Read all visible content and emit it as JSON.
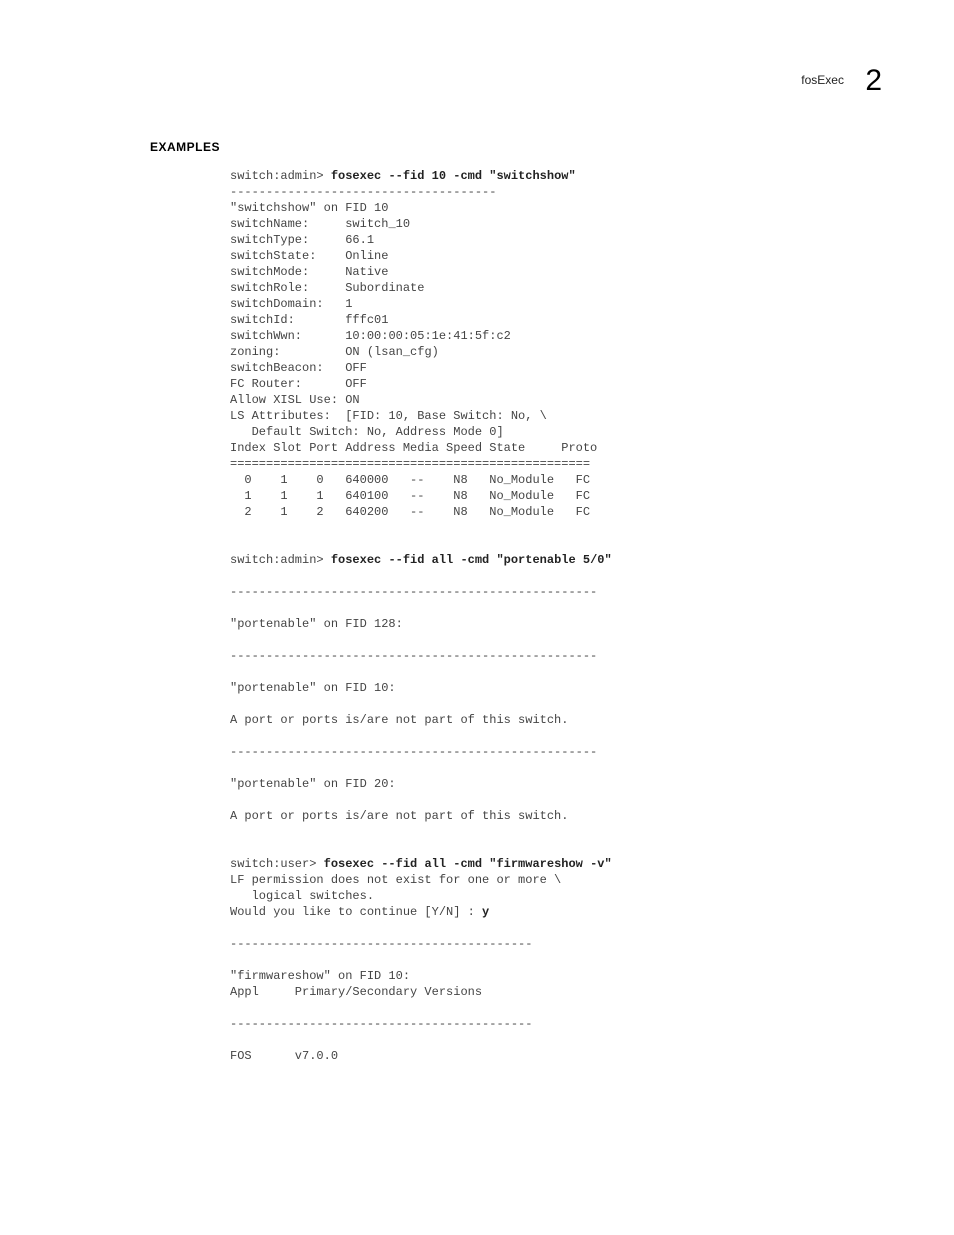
{
  "header": {
    "title": "fosExec",
    "chapter_num": "2"
  },
  "section_label": "EXAMPLES",
  "block1": {
    "prompt": "switch:admin> ",
    "cmd": "fosexec --fid 10 -cmd \"switchshow\"",
    "sep": "-------------------------------------",
    "line_head": "\"switchshow\" on FID 10",
    "kv": [
      [
        "switchName:",
        "switch_10"
      ],
      [
        "switchType:",
        "66.1"
      ],
      [
        "switchState:",
        "Online"
      ],
      [
        "switchMode:",
        "Native"
      ],
      [
        "switchRole:",
        "Subordinate"
      ],
      [
        "switchDomain:",
        "1"
      ],
      [
        "switchId:",
        "fffc01"
      ],
      [
        "switchWwn:",
        "10:00:00:05:1e:41:5f:c2"
      ],
      [
        "zoning:",
        "ON (lsan_cfg)"
      ],
      [
        "switchBeacon:",
        "OFF"
      ],
      [
        "FC Router:",
        "OFF"
      ],
      [
        "Allow XISL Use:",
        "ON"
      ]
    ],
    "ls_attr_a": "LS Attributes:  [FID: 10, Base Switch: No, \\",
    "ls_attr_b": "   Default Switch: No, Address Mode 0]",
    "table_hdr": "Index Slot Port Address Media Speed State     Proto",
    "table_sep": "==================================================",
    "rows": [
      "  0    1    0   640000   --    N8   No_Module   FC",
      "  1    1    1   640100   --    N8   No_Module   FC",
      "  2    1    2   640200   --    N8   No_Module   FC"
    ]
  },
  "block2": {
    "prompt": "switch:admin> ",
    "cmd": "fosexec --fid all -cmd \"portenable 5/0\"",
    "sep": "---------------------------------------------------",
    "l1": "\"portenable\" on FID 128:",
    "l2": "\"portenable\" on FID 10:",
    "l3": "A port or ports is/are not part of this switch.",
    "l4": "\"portenable\" on FID 20:",
    "l5": "A port or ports is/are not part of this switch."
  },
  "block3": {
    "prompt": "switch:user> ",
    "cmd": "fosexec --fid all -cmd \"firmwareshow -v\"",
    "p1a": "LF permission does not exist for one or more \\",
    "p1b": "   logical switches.",
    "q": "Would you like to continue [Y/N] : ",
    "ans": "y",
    "sep": "------------------------------------------",
    "fw_head": "\"firmwareshow\" on FID 10:",
    "appl": "Appl     Primary/Secondary Versions",
    "fos": "FOS      v7.0.0"
  }
}
